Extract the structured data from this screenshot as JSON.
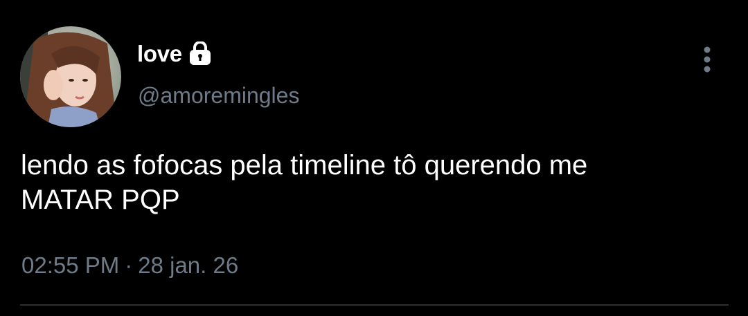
{
  "user": {
    "display_name": "love",
    "handle": "@amoremingles",
    "protected_icon": "lock-icon",
    "avatar_alt": "profile photo"
  },
  "tweet": {
    "text": "lendo as fofocas pela timeline tô querendo me\nMATAR PQP",
    "time": "02:55 PM",
    "separator": "·",
    "date": "28 jan. 26"
  },
  "actions": {
    "more_icon": "more-vertical-icon"
  },
  "colors": {
    "background": "#000000",
    "primary_text": "#ffffff",
    "secondary_text": "#6e7b88",
    "divider": "#2a2f33"
  }
}
